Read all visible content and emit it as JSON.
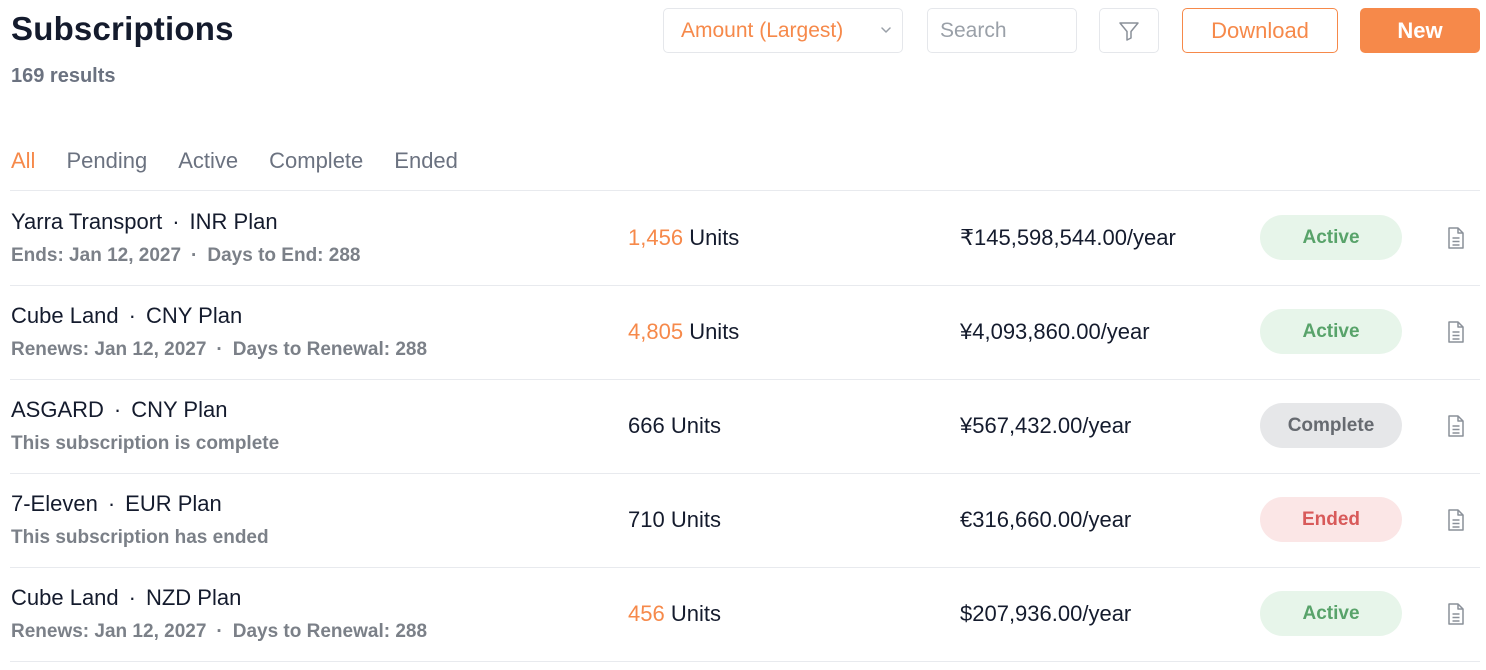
{
  "header": {
    "title": "Subscriptions",
    "results": "169 results"
  },
  "toolbar": {
    "sort_value": "Amount (Largest)",
    "search_placeholder": "Search",
    "download_label": "Download",
    "new_label": "New"
  },
  "colors": {
    "accent": "#f6894a",
    "active_badge_bg": "#e7f5ea",
    "active_badge_text": "#58a36a",
    "complete_badge_bg": "#e6e7e9",
    "ended_badge_bg": "#fbe6e6",
    "ended_badge_text": "#d85a5a"
  },
  "tabs": [
    {
      "label": "All",
      "active": true
    },
    {
      "label": "Pending",
      "active": false
    },
    {
      "label": "Active",
      "active": false
    },
    {
      "label": "Complete",
      "active": false
    },
    {
      "label": "Ended",
      "active": false
    }
  ],
  "rows": [
    {
      "company": "Yarra Transport",
      "plan": "INR Plan",
      "sub": "Ends: Jan 12, 2027",
      "sub2": "Days to End: 288",
      "units_num": "1,456",
      "units_label": "Units",
      "units_highlight": true,
      "price": "₹145,598,544.00/year",
      "status": "Active",
      "status_type": "active"
    },
    {
      "company": "Cube Land",
      "plan": "CNY Plan",
      "sub": "Renews: Jan 12, 2027",
      "sub2": "Days to Renewal: 288",
      "units_num": "4,805",
      "units_label": "Units",
      "units_highlight": true,
      "price": "¥4,093,860.00/year",
      "status": "Active",
      "status_type": "active"
    },
    {
      "company": "ASGARD",
      "plan": "CNY Plan",
      "sub": "This subscription is complete",
      "sub2": "",
      "units_num": "666",
      "units_label": "Units",
      "units_highlight": false,
      "price": "¥567,432.00/year",
      "status": "Complete",
      "status_type": "complete"
    },
    {
      "company": "7-Eleven",
      "plan": "EUR Plan",
      "sub": "This subscription has ended",
      "sub2": "",
      "units_num": "710",
      "units_label": "Units",
      "units_highlight": false,
      "price": "€316,660.00/year",
      "status": "Ended",
      "status_type": "ended"
    },
    {
      "company": "Cube Land",
      "plan": "NZD Plan",
      "sub": "Renews: Jan 12, 2027",
      "sub2": "Days to Renewal: 288",
      "units_num": "456",
      "units_label": "Units",
      "units_highlight": true,
      "price": "$207,936.00/year",
      "status": "Active",
      "status_type": "active"
    }
  ]
}
